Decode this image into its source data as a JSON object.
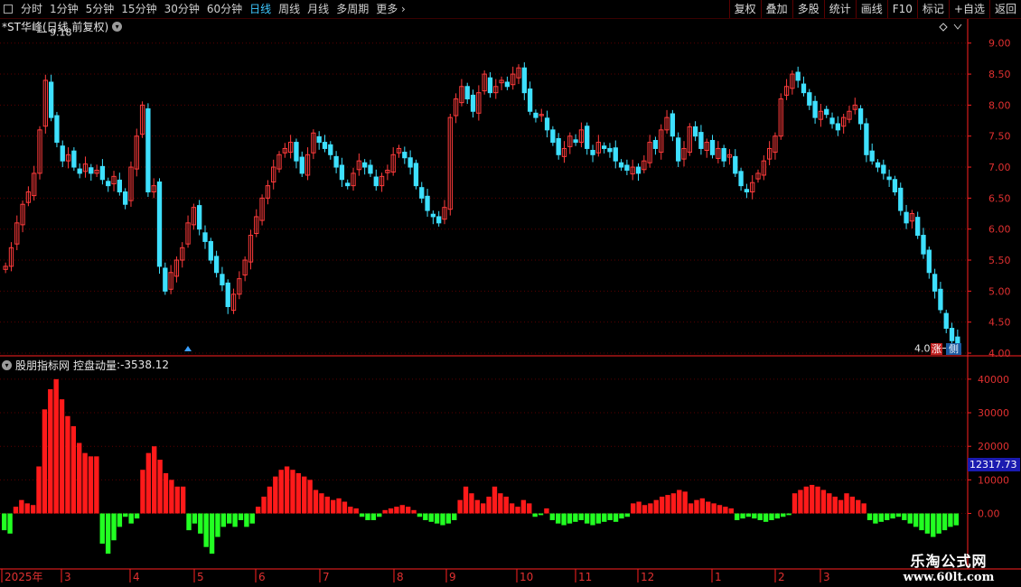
{
  "toolbar": {
    "periods": [
      "分时",
      "1分钟",
      "5分钟",
      "15分钟",
      "30分钟",
      "60分钟",
      "日线",
      "周线",
      "月线",
      "多周期",
      "更多"
    ],
    "active_period": "日线",
    "right_buttons": [
      "复权",
      "叠加",
      "多股",
      "统计",
      "画线",
      "F10",
      "标记",
      "+自选",
      "返回"
    ]
  },
  "main_chart": {
    "title": "*ST华峰(日线 前复权)",
    "price_ticks": [
      "9.00",
      "8.50",
      "8.00",
      "7.50",
      "7.00",
      "6.50",
      "6.00",
      "5.50",
      "5.00",
      "4.50",
      "4.00"
    ],
    "high_label": "9.18",
    "low_label": "4.08",
    "badge_zhang": "涨",
    "badge_side": "侧",
    "colors": {
      "up": "#ff3b3b",
      "down": "#3ee0ff",
      "grid": "#5a0000",
      "axis": "#ff2020"
    }
  },
  "indicator": {
    "source": "股朋指标网",
    "name": "控盘动量",
    "value": "-3538.12",
    "ticks": [
      "40000",
      "30000",
      "20000",
      "10000",
      "0.00"
    ],
    "highlight_value": "12317.73",
    "colors": {
      "positive": "#ff1a1a",
      "negative": "#22ff22"
    }
  },
  "time_axis": [
    "2025年",
    "3",
    "4",
    "5",
    "6",
    "7",
    "8",
    "9",
    "10",
    "11",
    "12",
    "1",
    "2",
    "3"
  ],
  "watermark": {
    "line1": "乐淘公式网",
    "line2": "www.60lt.com"
  },
  "chart_data": [
    {
      "type": "candlestick",
      "title": "*ST华峰(日线 前复权)",
      "ylim": [
        4.0,
        9.2
      ],
      "y_ticks": [
        4.0,
        4.5,
        5.0,
        5.5,
        6.0,
        6.5,
        7.0,
        7.5,
        8.0,
        8.5,
        9.0
      ],
      "x_labels": [
        "2025年",
        "3",
        "4",
        "5",
        "6",
        "7",
        "8",
        "9",
        "10",
        "11",
        "12",
        "1",
        "2",
        "3"
      ],
      "close": [
        5.4,
        5.7,
        6.1,
        6.4,
        6.6,
        6.9,
        7.6,
        8.4,
        7.8,
        7.4,
        7.1,
        7.2,
        7.0,
        6.9,
        7.05,
        6.9,
        6.95,
        6.8,
        6.7,
        6.85,
        6.6,
        6.4,
        7.0,
        7.5,
        8.0,
        6.6,
        6.7,
        5.4,
        5.0,
        5.3,
        5.5,
        5.7,
        6.1,
        6.35,
        6.0,
        5.8,
        5.5,
        5.3,
        5.1,
        4.75,
        4.95,
        5.2,
        5.5,
        5.9,
        6.2,
        6.5,
        6.7,
        7.0,
        7.2,
        7.3,
        7.4,
        7.1,
        6.9,
        7.2,
        7.55,
        7.4,
        7.3,
        7.2,
        7.0,
        6.8,
        6.7,
        6.9,
        7.1,
        7.0,
        6.9,
        6.7,
        6.85,
        6.95,
        7.2,
        7.3,
        7.15,
        7.0,
        6.7,
        6.5,
        6.3,
        6.2,
        6.1,
        6.35,
        7.8,
        8.1,
        8.3,
        8.1,
        7.9,
        8.2,
        8.5,
        8.2,
        8.3,
        8.4,
        8.3,
        8.5,
        8.6,
        8.2,
        7.9,
        7.8,
        7.85,
        7.6,
        7.4,
        7.2,
        7.3,
        7.5,
        7.4,
        7.6,
        7.3,
        7.2,
        7.4,
        7.3,
        7.25,
        7.1,
        7.0,
        6.95,
        7.0,
        6.9,
        7.1,
        7.4,
        7.3,
        7.6,
        7.8,
        7.5,
        7.1,
        7.3,
        7.65,
        7.5,
        7.3,
        7.4,
        7.2,
        7.3,
        7.1,
        7.2,
        6.9,
        6.7,
        6.6,
        6.75,
        6.9,
        7.1,
        7.3,
        7.5,
        8.1,
        8.3,
        8.5,
        8.4,
        8.2,
        8.0,
        7.8,
        7.9,
        7.85,
        7.7,
        7.6,
        7.8,
        7.9,
        8.0,
        7.7,
        7.2,
        7.1,
        7.0,
        6.9,
        6.8,
        6.6,
        6.3,
        6.1,
        6.25,
        5.9,
        5.6,
        5.3,
        5.0,
        4.7,
        4.4,
        4.2,
        4.1
      ]
    },
    {
      "type": "bar",
      "title": "控盘动量",
      "ylim": [
        -16000,
        44000
      ],
      "y_ticks": [
        0,
        10000,
        20000,
        30000,
        40000
      ],
      "last_value": -3538.12,
      "values": [
        -5000,
        -6000,
        2000,
        4000,
        3000,
        2500,
        14000,
        31000,
        37000,
        40000,
        34000,
        29000,
        26000,
        21000,
        18000,
        17000,
        17000,
        -9000,
        -12000,
        -8000,
        -4000,
        -1000,
        -3000,
        -1500,
        13000,
        18000,
        20000,
        16000,
        12000,
        10000,
        8000,
        8000,
        -5000,
        -3000,
        -6000,
        -10000,
        -12000,
        -7000,
        -4000,
        -3000,
        -4000,
        -2000,
        -4000,
        -3000,
        2000,
        5000,
        8000,
        11000,
        13000,
        14000,
        13000,
        12000,
        11000,
        10000,
        7000,
        6000,
        5000,
        4000,
        4500,
        3500,
        2000,
        1500,
        -1000,
        -2000,
        -2000,
        -1000,
        1000,
        1500,
        2000,
        2500,
        2000,
        1000,
        -1000,
        -2000,
        -2500,
        -3000,
        -3500,
        -3000,
        -2000,
        4000,
        8000,
        6000,
        4000,
        3000,
        5000,
        8000,
        6000,
        5000,
        3000,
        2000,
        4000,
        3000,
        -1000,
        -500,
        1500,
        -2000,
        -3000,
        -3500,
        -3000,
        -2500,
        -2000,
        -3000,
        -3500,
        -3000,
        -2500,
        -2000,
        -2500,
        -1500,
        -1000,
        3000,
        3500,
        2500,
        3000,
        4000,
        5000,
        5500,
        6000,
        7000,
        6500,
        3000,
        4000,
        4500,
        3500,
        3000,
        2500,
        2000,
        1500,
        -2000,
        -1500,
        -1000,
        -1500,
        -2000,
        -2500,
        -2000,
        -1500,
        -1000,
        -500,
        6000,
        7000,
        8000,
        8500,
        8000,
        7000,
        6000,
        5000,
        4000,
        6000,
        5000,
        4000,
        3000,
        -2000,
        -3000,
        -2500,
        -2000,
        -1500,
        -1000,
        -2000,
        -3000,
        -4000,
        -5000,
        -6000,
        -7000,
        -6000,
        -5000,
        -4000,
        -3538.12
      ]
    }
  ]
}
